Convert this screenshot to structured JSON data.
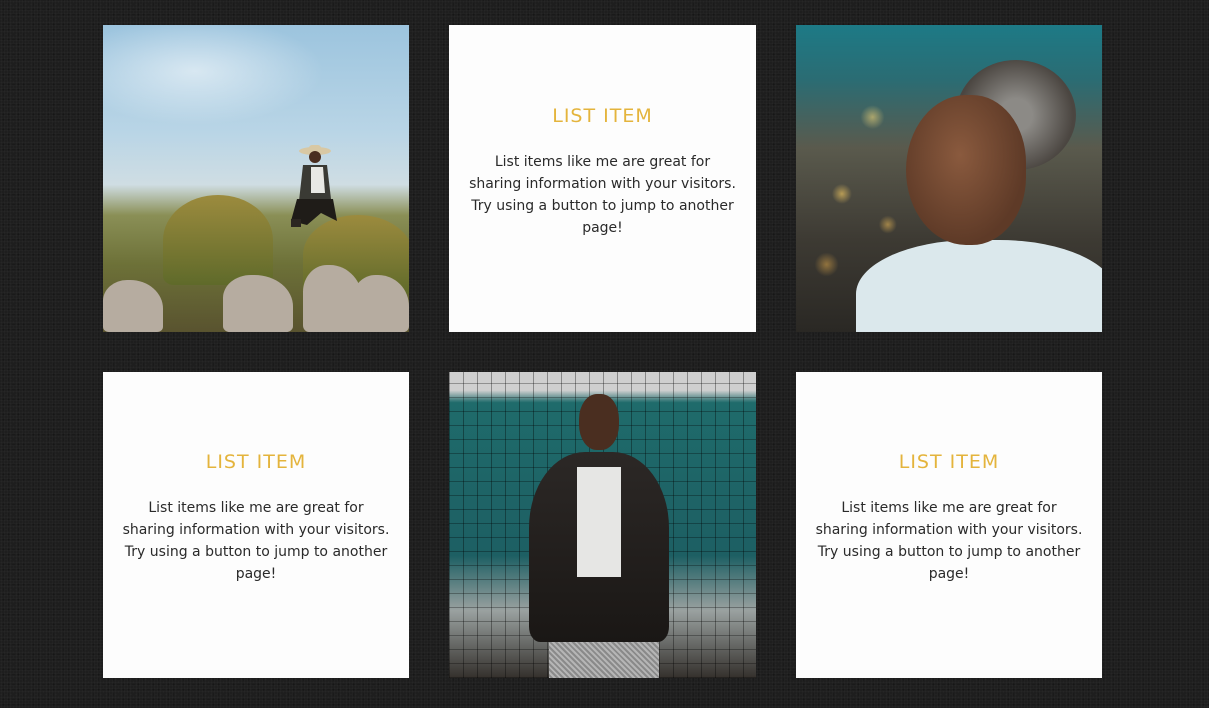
{
  "tiles": [
    {
      "kind": "image",
      "icon": "photo-person-on-rocks"
    },
    {
      "kind": "text",
      "title": "LIST ITEM",
      "body": "List items like me are great for sharing information with your visitors. Try using a button to jump to another page!"
    },
    {
      "kind": "image",
      "icon": "photo-smiling-woman"
    },
    {
      "kind": "text",
      "title": "LIST ITEM",
      "body": "List items like me are great for sharing information with your visitors. Try using a button to jump to another page!"
    },
    {
      "kind": "image",
      "icon": "photo-man-in-leather-jacket"
    },
    {
      "kind": "text",
      "title": "LIST ITEM",
      "body": "List items like me are great for sharing information with your visitors. Try using a button to jump to another page!"
    }
  ],
  "colors": {
    "background": "#1e1e1e",
    "tile": "#fdfdfd",
    "accent": "#e4b43c",
    "text": "#2a2a2a"
  }
}
